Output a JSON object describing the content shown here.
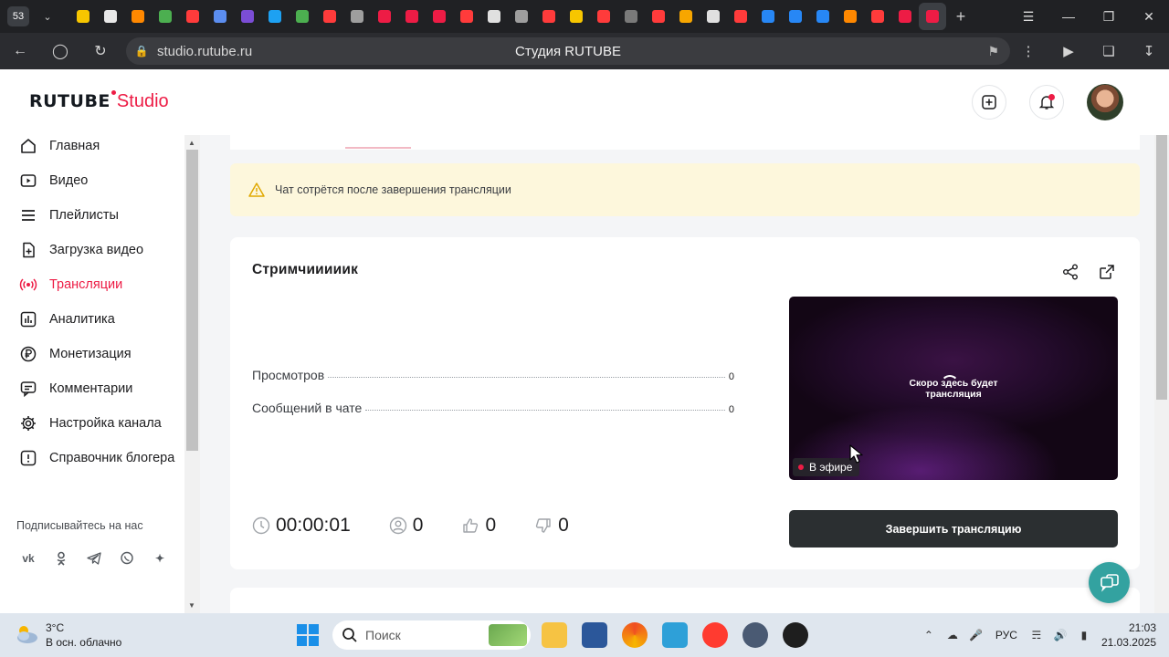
{
  "browser": {
    "tab_count": "53",
    "url": "studio.rutube.ru",
    "page_title": "Студия RUTUBE",
    "tab_favicons": [
      "#f7c600",
      "#e8e8e8",
      "#ff8800",
      "#4caf50",
      "#ff3b3b",
      "#5b8def",
      "#7b4dd6",
      "#1da1f2",
      "#4caf50",
      "#ff3b3b",
      "#9e9e9e",
      "#ed1c45",
      "#ed1c45",
      "#ed1c45",
      "#ff3b3b",
      "#e0e0e0",
      "#9e9e9e",
      "#ff3b3b",
      "#f7c600",
      "#ff3b3b",
      "#7a7a7a",
      "#ff3b3b",
      "#f7a600",
      "#e0e0e0",
      "#ff3b3b",
      "#2787f5",
      "#2787f5",
      "#2787f5",
      "#ff8800",
      "#ff3b3b",
      "#ed1c45",
      "#ed1c45"
    ]
  },
  "header": {
    "logo_main": "RUTUBE",
    "logo_sub": "Studio"
  },
  "sidebar": {
    "items": [
      {
        "label": "Главная",
        "icon": "home-icon"
      },
      {
        "label": "Видео",
        "icon": "video-icon"
      },
      {
        "label": "Плейлисты",
        "icon": "playlist-icon"
      },
      {
        "label": "Загрузка видео",
        "icon": "upload-icon"
      },
      {
        "label": "Трансляции",
        "icon": "broadcast-icon",
        "active": true
      },
      {
        "label": "Аналитика",
        "icon": "analytics-icon"
      },
      {
        "label": "Монетизация",
        "icon": "ruble-icon"
      },
      {
        "label": "Комментарии",
        "icon": "comment-icon"
      },
      {
        "label": "Настройка канала",
        "icon": "gear-icon"
      },
      {
        "label": "Справочник блогера",
        "icon": "help-icon"
      }
    ],
    "follow_label": "Подписывайтесь на нас",
    "socials": [
      "vk-icon",
      "ok-icon",
      "telegram-icon",
      "viber-icon",
      "more-icon"
    ]
  },
  "notice": {
    "text": "Чат сотрётся после завершения трансляции"
  },
  "stream": {
    "title": "Стримчииииик",
    "stats": [
      {
        "label": "Просмотров",
        "value": "0"
      },
      {
        "label": "Сообщений в чате",
        "value": "0"
      }
    ],
    "metrics": {
      "duration": "00:00:01",
      "viewers": "0",
      "likes": "0",
      "dislikes": "0"
    },
    "player_message_line1": "Скоро здесь будет",
    "player_message_line2": "трансляция",
    "live_label": "В эфире",
    "end_button": "Завершить трансляцию"
  },
  "taskbar": {
    "temperature": "3°C",
    "weather": "В осн. облачно",
    "search_placeholder": "Поиск",
    "language": "РУС",
    "time": "21:03",
    "date": "21.03.2025"
  },
  "colors": {
    "accent": "#ed1c45",
    "notice_bg": "#fdf7dc",
    "button_dark": "#2b2f31",
    "help_fab": "#33a2a0"
  }
}
